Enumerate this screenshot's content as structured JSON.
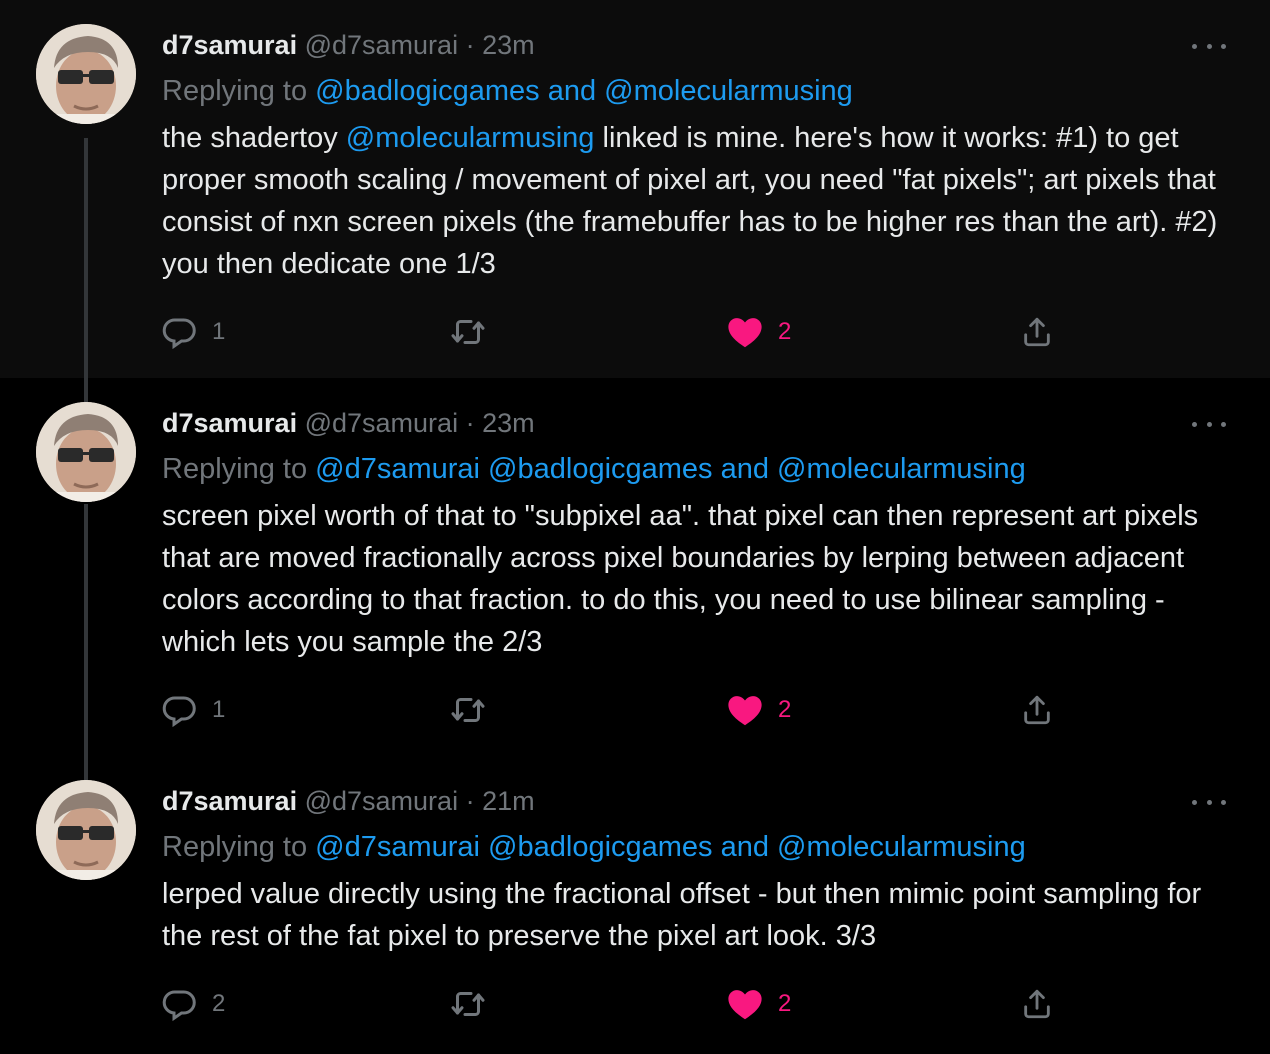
{
  "colors": {
    "background": "#000000",
    "text": "#e7e9ea",
    "muted": "#71767b",
    "link": "#1d9bf0",
    "like": "#f91880"
  },
  "icons": {
    "reply": "reply-icon",
    "retweet": "retweet-icon",
    "like": "heart-icon",
    "share": "share-icon",
    "more": "more-icon"
  },
  "tweets": [
    {
      "name": "d7samurai",
      "handle": "@d7samurai",
      "separator": "·",
      "time": "23m",
      "replying_label": "Replying to",
      "replying_mentions": "@badlogicgames and @molecularmusing",
      "text_before": "the shadertoy ",
      "text_mention": "@molecularmusing",
      "text_after": " linked is mine. here's how it works: #1) to get proper smooth scaling / movement of pixel art, you need \"fat pixels\"; art pixels that consist of nxn screen pixels (the framebuffer has to be higher res than the art). #2) you then dedicate one 1/3",
      "replies": "1",
      "likes": "2"
    },
    {
      "name": "d7samurai",
      "handle": "@d7samurai",
      "separator": "·",
      "time": "23m",
      "replying_label": "Replying to",
      "replying_mentions": "@d7samurai @badlogicgames and @molecularmusing",
      "text": "screen pixel worth of that to \"subpixel aa\". that pixel can then represent art pixels that are moved fractionally across pixel boundaries by lerping between adjacent colors according to that fraction. to do this, you need to use bilinear sampling - which lets you sample the 2/3",
      "replies": "1",
      "likes": "2"
    },
    {
      "name": "d7samurai",
      "handle": "@d7samurai",
      "separator": "·",
      "time": "21m",
      "replying_label": "Replying to",
      "replying_mentions": "@d7samurai @badlogicgames and @molecularmusing",
      "text": "lerped value directly using the fractional offset - but then mimic point sampling for the rest of the fat pixel to preserve the pixel art look. 3/3",
      "replies": "2",
      "likes": "2"
    }
  ]
}
